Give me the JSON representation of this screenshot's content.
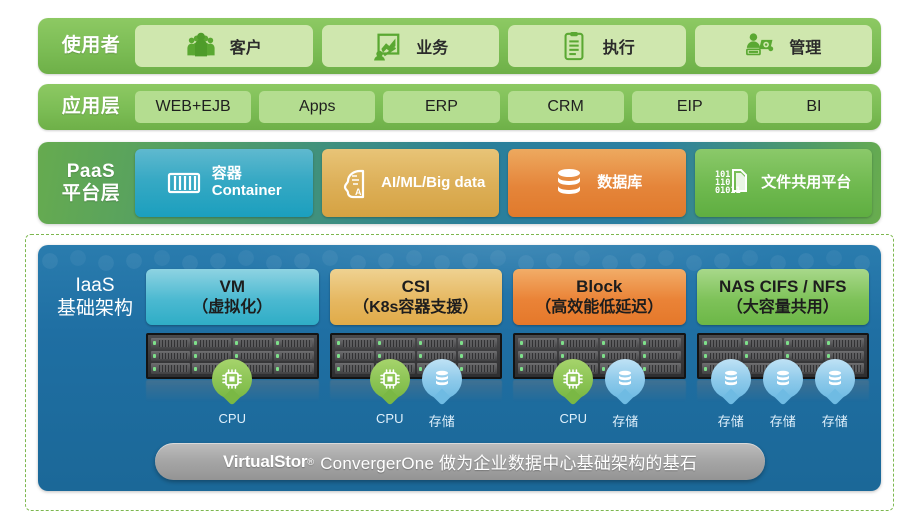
{
  "layers": {
    "users": {
      "label": "使用者",
      "items": [
        {
          "label": "客户",
          "icon": "people-group-icon"
        },
        {
          "label": "业务",
          "icon": "chart-growth-icon"
        },
        {
          "label": "执行",
          "icon": "clipboard-icon"
        },
        {
          "label": "管理",
          "icon": "person-settings-icon"
        }
      ]
    },
    "applications": {
      "label": "应用层",
      "items": [
        "WEB+EJB",
        "Apps",
        "ERP",
        "CRM",
        "EIP",
        "BI"
      ]
    },
    "paas": {
      "label_line1": "PaaS",
      "label_line2": "平台层",
      "items": [
        {
          "line1": "容器",
          "line2": "Container",
          "icon": "container-icon",
          "color": "#2aa6c3"
        },
        {
          "line1": "AI/ML/Big data",
          "line2": "",
          "icon": "ai-brain-icon",
          "color": "#ddb059"
        },
        {
          "line1": "数据库",
          "line2": "",
          "icon": "database-icon",
          "color": "#e5853a"
        },
        {
          "line1": "文件共用平台",
          "line2": "",
          "icon": "binary-file-icon",
          "color": "#6fb94f"
        }
      ]
    },
    "iaas": {
      "label_line1": "IaaS",
      "label_line2": "基础架构",
      "columns": [
        {
          "title": "VM",
          "subtitle": "（虚拟化）",
          "color": "#3fb4cb",
          "devices": [
            {
              "label": "CPU",
              "icon": "cpu-chip-icon",
              "type": "cpu"
            }
          ]
        },
        {
          "title": "CSI",
          "subtitle": "（K8s容器支援）",
          "color": "#e6b862",
          "devices": [
            {
              "label": "CPU",
              "icon": "cpu-chip-icon",
              "type": "cpu"
            },
            {
              "label": "存储",
              "icon": "storage-disk-icon",
              "type": "storage"
            }
          ]
        },
        {
          "title": "Block",
          "subtitle": "（高效能低延迟）",
          "color": "#ea8337",
          "devices": [
            {
              "label": "CPU",
              "icon": "cpu-chip-icon",
              "type": "cpu"
            },
            {
              "label": "存储",
              "icon": "storage-disk-icon",
              "type": "storage"
            }
          ]
        },
        {
          "title": "NAS CIFS / NFS",
          "subtitle": "（大容量共用）",
          "color": "#7ec259",
          "devices": [
            {
              "label": "存储",
              "icon": "storage-disk-icon",
              "type": "storage"
            },
            {
              "label": "存储",
              "icon": "storage-disk-icon",
              "type": "storage"
            },
            {
              "label": "存储",
              "icon": "storage-disk-icon",
              "type": "storage"
            }
          ]
        }
      ]
    }
  },
  "banner": {
    "brand": "VirtualStor",
    "registered_mark": "®",
    "text": "ConvergerOne 做为企业数据中心基础架构的基石"
  },
  "colors": {
    "green_row": "#7cbd55",
    "green_cell_light": "#cfe7ae",
    "green_cell": "#b4dd90",
    "iaas_blue": "#1f6fa3",
    "dashed_border": "#7db84f",
    "banner_grey": "#a7a7a7"
  }
}
